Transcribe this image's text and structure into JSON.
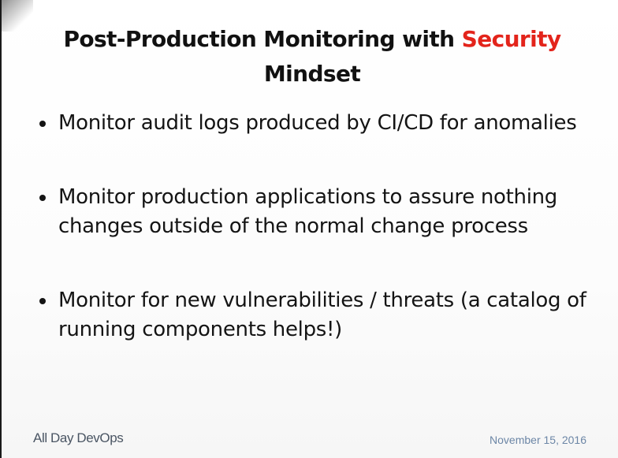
{
  "slide": {
    "title_main": "Post-Production Monitoring  with ",
    "title_accent": "Security",
    "title_end": "Mindset",
    "accent_color": "#e3241b",
    "bullets": [
      {
        "text": "Monitor audit logs produced by CI/CD for anomalies"
      },
      {
        "text": "Monitor production applications to assure nothing changes outside of the normal change process"
      },
      {
        "text": "Monitor for new vulnerabilities / threats (a catalog of running components helps!)"
      }
    ]
  },
  "footer": {
    "brand": "All Day DevOps",
    "date": "November 15, 2016"
  }
}
